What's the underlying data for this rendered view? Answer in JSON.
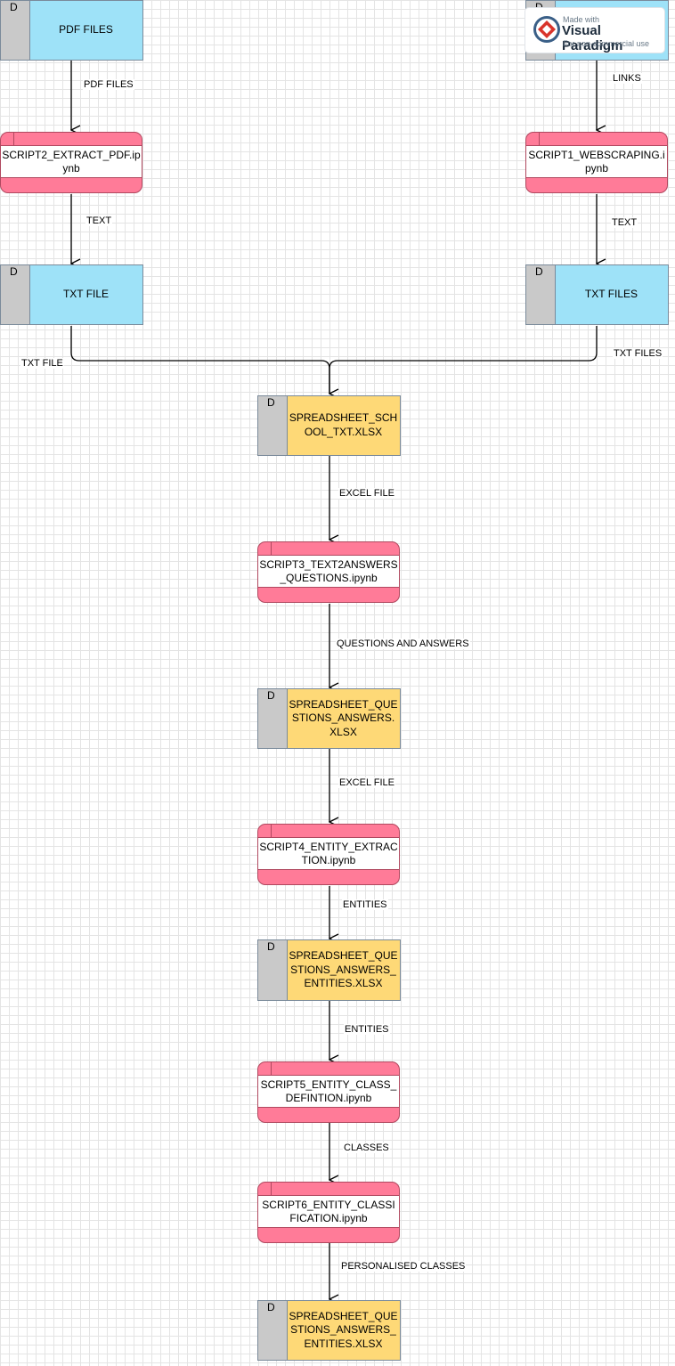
{
  "colors": {
    "store_blue": "#9ee2f8",
    "store_yellow": "#fed977",
    "process_pink": "#ff7b98",
    "store_tab": "#c9c9c9"
  },
  "stores": {
    "pdf_files": {
      "tag": "D",
      "label": "PDF FILES"
    },
    "links": {
      "tag": "D",
      "label": ""
    },
    "txt_file": {
      "tag": "D",
      "label": "TXT FILE"
    },
    "txt_files": {
      "tag": "D",
      "label": "TXT FILES"
    },
    "spreadsheet_school_txt": {
      "tag": "D",
      "label": "SPREADSHEET_SCHOOL_TXT.XLSX"
    },
    "spreadsheet_qa": {
      "tag": "D",
      "label": "SPREADSHEET_QUESTIONS_ANSWERS.XLSX"
    },
    "spreadsheet_qa_entities_1": {
      "tag": "D",
      "label": "SPREADSHEET_QUESTIONS_ANSWERS_ENTITIES.XLSX"
    },
    "spreadsheet_qa_entities_2": {
      "tag": "D",
      "label": "SPREADSHEET_QUESTIONS_ANSWERS_ENTITIES.XLSX"
    }
  },
  "processes": {
    "script2": "SCRIPT2_EXTRACT_PDF.ipynb",
    "script1": "SCRIPT1_WEBSCRAPING.ipynb",
    "script3": "SCRIPT3_TEXT2ANSWERS_QUESTIONS.ipynb",
    "script4": "SCRIPT4_ENTITY_EXTRACTION.ipynb",
    "script5": "SCRIPT5_ENTITY_CLASS_DEFINTION.ipynb",
    "script6": "SCRIPT6_ENTITY_CLASSIFICATION.ipynb"
  },
  "flows": {
    "pdf_files": "PDF FILES",
    "links": "LINKS",
    "text_left": "TEXT",
    "text_right": "TEXT",
    "txt_file": "TXT FILE",
    "txt_files": "TXT FILES",
    "excel_file_1": "EXCEL FILE",
    "questions_answers": "QUESTIONS AND ANSWERS",
    "excel_file_2": "EXCEL FILE",
    "entities_1": "ENTITIES",
    "entities_2": "ENTITIES",
    "classes": "CLASSES",
    "personalised_classes": "PERSONALISED CLASSES"
  },
  "watermark": {
    "line1": "Made with",
    "line2": "Visual Paradigm",
    "line3": "For non-commercial use"
  }
}
